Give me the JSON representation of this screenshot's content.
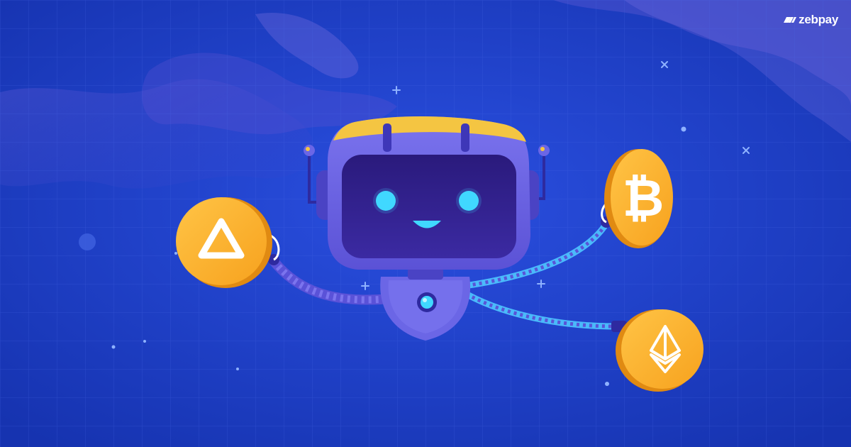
{
  "brand": {
    "name": "zebpay",
    "logo_icon": "zebpay-stripes-logo-icon"
  },
  "illustration": {
    "subject": "robot-icon",
    "coins": [
      {
        "icon": "bat-triangle-icon",
        "side": "left"
      },
      {
        "icon": "bitcoin-icon",
        "side": "upper-right"
      },
      {
        "icon": "ethereum-icon",
        "side": "lower-right"
      }
    ]
  },
  "colors": {
    "background": "#1c3fc6",
    "background_deep": "#1732a8",
    "grid": "#4a6be6",
    "robot_body": "#6b66e6",
    "robot_body_light": "#8a86f5",
    "screen": "#2e1f8a",
    "robot_eye": "#40d8ff",
    "coin": "#ffb22c",
    "coin_edge": "#e08a12",
    "arm_glow": "#4fc7ff",
    "antenna_tip": "#f4c542"
  }
}
